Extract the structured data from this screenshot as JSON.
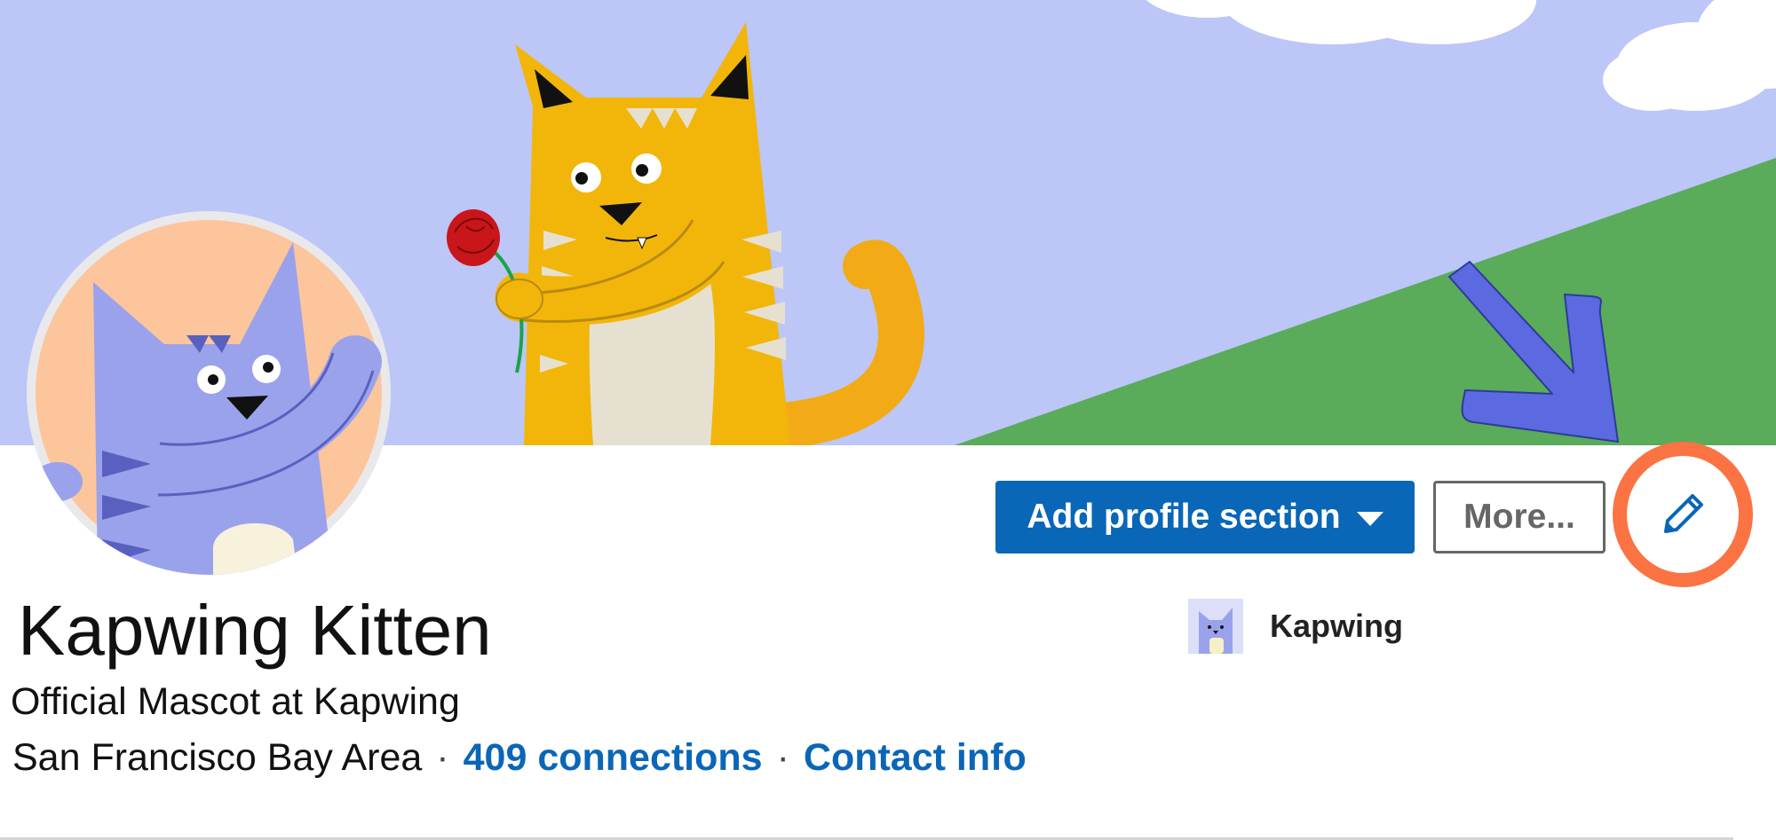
{
  "profile": {
    "name": "Kapwing Kitten",
    "headline": "Official Mascot at Kapwing",
    "location": "San Francisco Bay Area",
    "connections": "409 connections",
    "contact_info": "Contact info",
    "separator": "·"
  },
  "actions": {
    "add_section_label": "Add profile section",
    "more_label": "More..."
  },
  "company": {
    "name": "Kapwing"
  },
  "icons": {
    "edit": "pencil-icon",
    "dropdown": "caret-down-icon",
    "annotation_arrow": "arrow-icon"
  },
  "colors": {
    "primary": "#0a66b7",
    "highlight_ring": "#fb7343",
    "annotation_arrow": "#5b6ae0",
    "banner_sky": "#bcc6f7",
    "banner_hill": "#5aab5a"
  }
}
